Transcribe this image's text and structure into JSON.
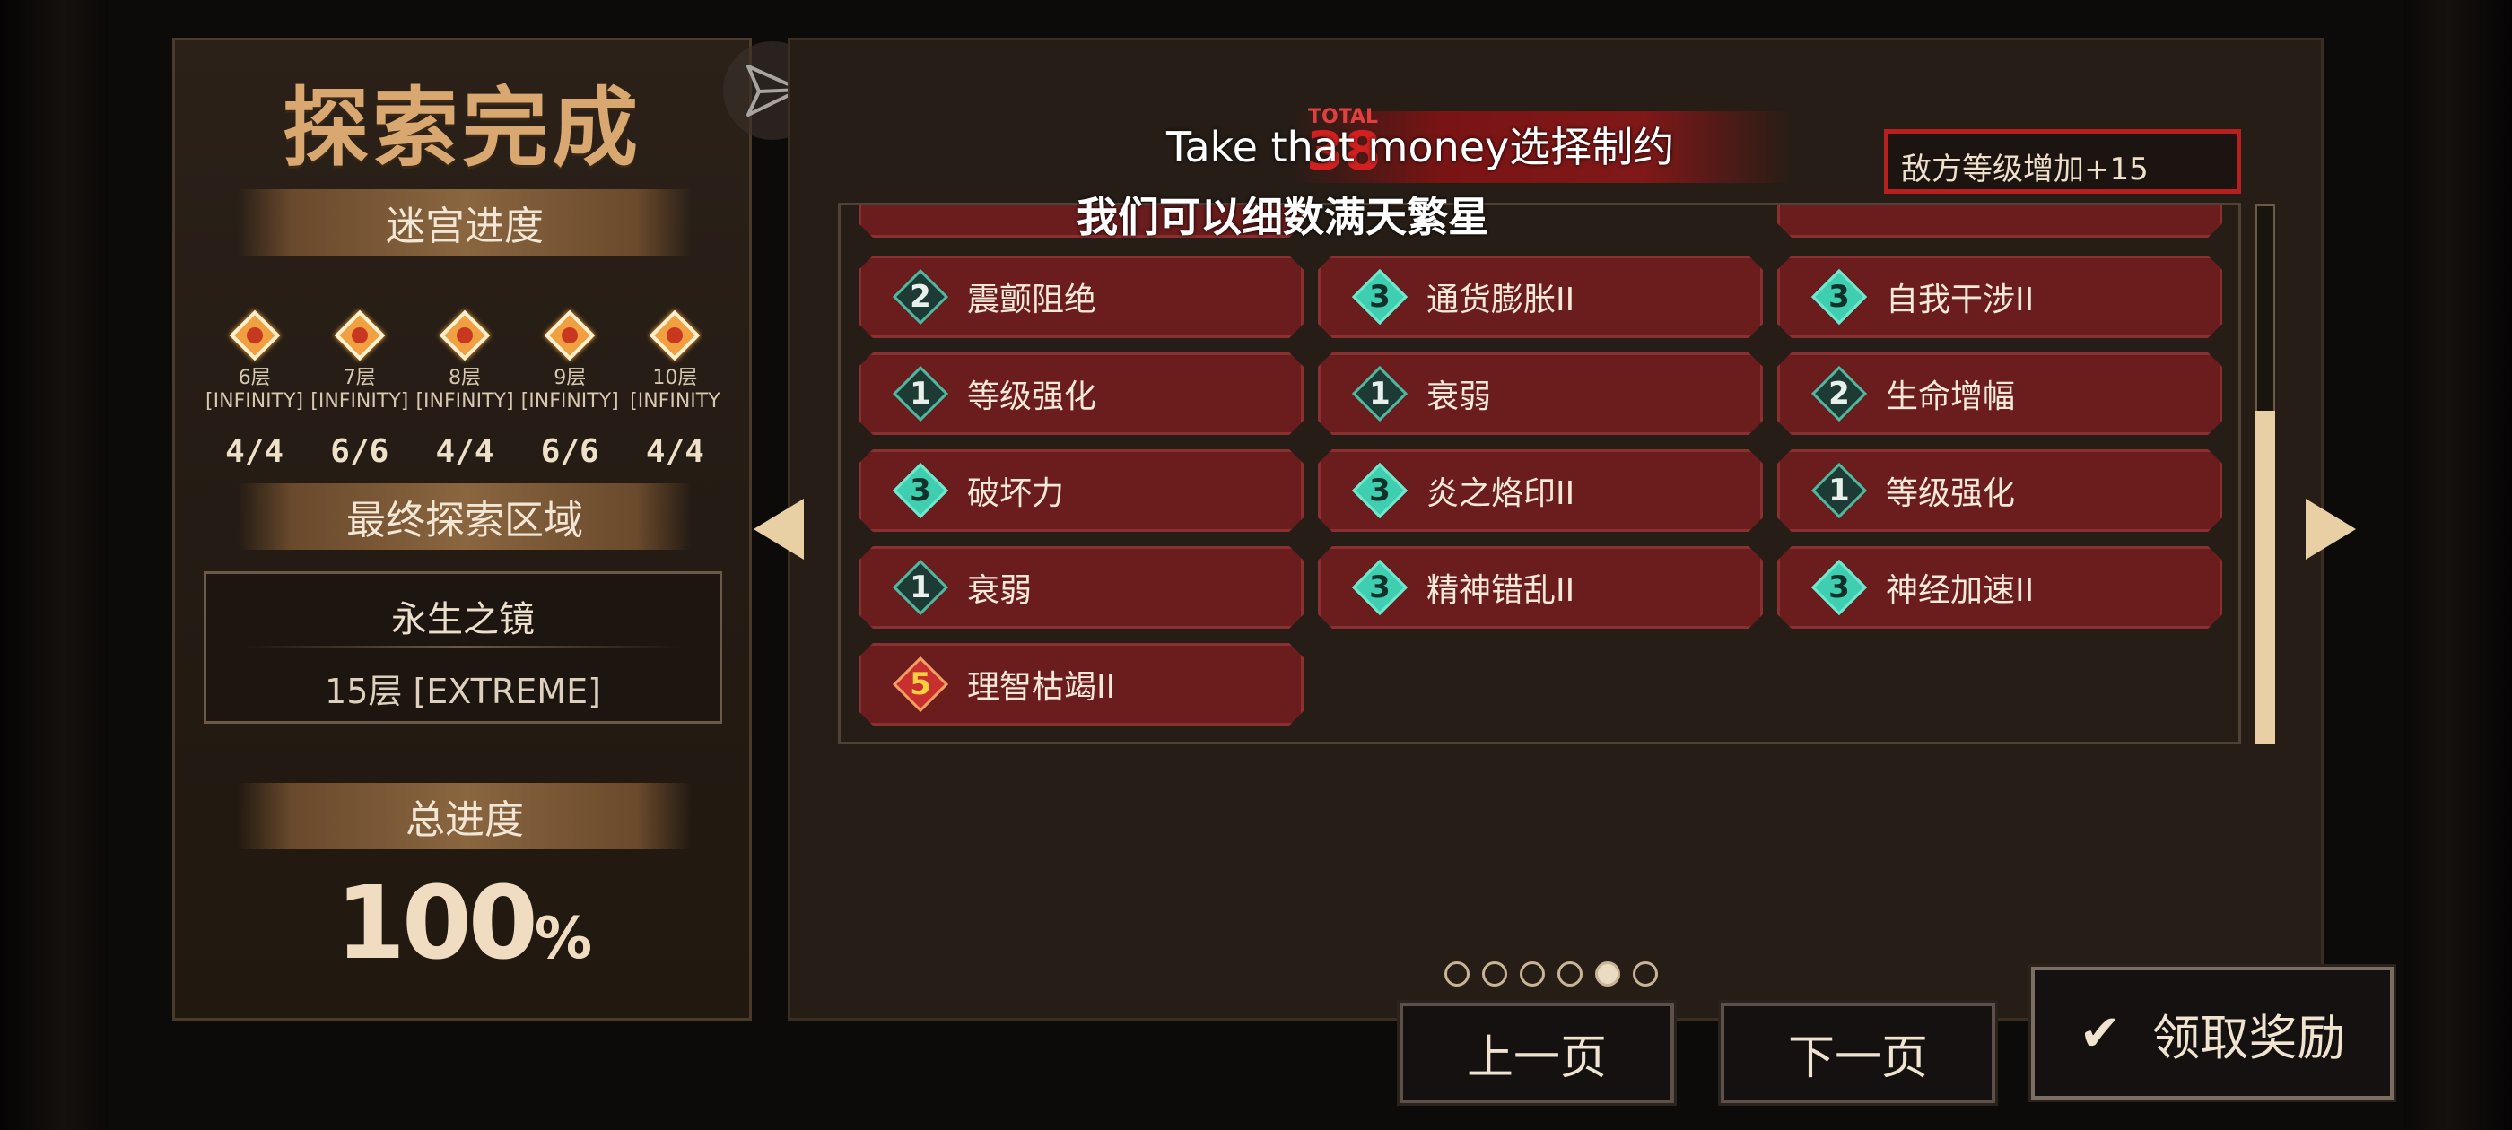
{
  "left": {
    "title": "探索完成",
    "maze_progress_label": "迷宫进度",
    "floors": [
      {
        "floor": "6层",
        "mode": "INFINITY]",
        "mode_prefix": "[",
        "count": "4/4"
      },
      {
        "floor": "7层",
        "mode": "[INFINITY]",
        "count": "6/6"
      },
      {
        "floor": "8层",
        "mode": "[INFINITY]",
        "count": "4/4"
      },
      {
        "floor": "9层",
        "mode": "[INFINITY]",
        "count": "6/6"
      },
      {
        "floor": "10层",
        "mode": "[INFINITY",
        "count": "4/4"
      }
    ],
    "final_zone_label": "最终探索区域",
    "zone_name": "永生之镜",
    "zone_level": "15层 [EXTREME]",
    "total_label": "总进度",
    "total_value": "100",
    "total_unit": "%"
  },
  "header": {
    "total_label": "TOTAL",
    "total_value": "38",
    "title_overlay": "Take that money选择制约",
    "subtitle_overlay": "我们可以细数满天繁星",
    "enemy_level": "敌方等级增加+15"
  },
  "cards": [
    {
      "level": "2",
      "name": "震颤阻绝",
      "tone": "dark"
    },
    {
      "level": "3",
      "name": "通货膨胀II",
      "tone": "teal"
    },
    {
      "level": "3",
      "name": "自我干涉II",
      "tone": "teal"
    },
    {
      "level": "1",
      "name": "等级强化",
      "tone": "dark"
    },
    {
      "level": "1",
      "name": "衰弱",
      "tone": "dark"
    },
    {
      "level": "2",
      "name": "生命增幅",
      "tone": "dark"
    },
    {
      "level": "3",
      "name": "破坏力",
      "tone": "teal"
    },
    {
      "level": "3",
      "name": "炎之烙印II",
      "tone": "teal"
    },
    {
      "level": "1",
      "name": "等级强化",
      "tone": "dark"
    },
    {
      "level": "1",
      "name": "衰弱",
      "tone": "dark"
    },
    {
      "level": "3",
      "name": "精神错乱II",
      "tone": "teal"
    },
    {
      "level": "3",
      "name": "神经加速II",
      "tone": "teal"
    },
    {
      "level": "5",
      "name": "理智枯竭II",
      "tone": "red"
    }
  ],
  "pagination": {
    "pages": 6,
    "current": 5
  },
  "buttons": {
    "prev": "上一页",
    "next": "下一页",
    "claim": "领取奖励",
    "claim_icon": "check-icon"
  },
  "colors": {
    "card_bg": "#6b1c1c",
    "teal_badge": "#3fcfb0",
    "dark_badge": "#1e3a34",
    "red_badge": "#c83030",
    "accent_gold": "#e8cfa4"
  }
}
